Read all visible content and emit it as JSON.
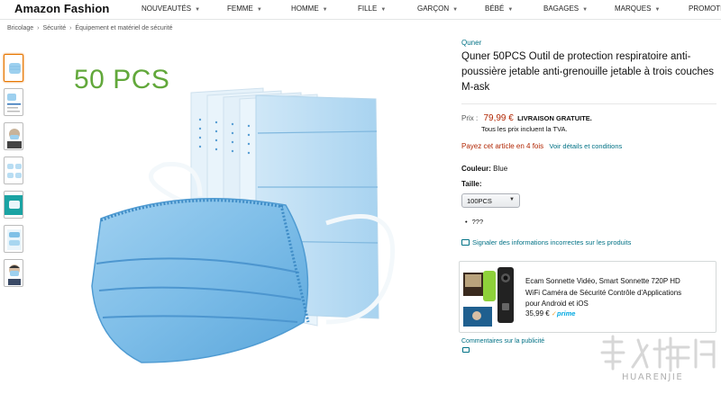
{
  "header": {
    "brand": "Amazon Fashion",
    "nav": [
      {
        "label": "NOUVEAUTÉS"
      },
      {
        "label": "FEMME"
      },
      {
        "label": "HOMME"
      },
      {
        "label": "FILLE"
      },
      {
        "label": "GARÇON"
      },
      {
        "label": "BÉBÉ"
      },
      {
        "label": "BAGAGES"
      },
      {
        "label": "MARQUES"
      },
      {
        "label": "PROMOTIO"
      }
    ]
  },
  "breadcrumb": {
    "items": [
      "Bricolage",
      "Sécurité",
      "Équipement et matériel de sécurité"
    ],
    "separator": "›"
  },
  "gallery": {
    "thumbnail_count": 7,
    "selected_index": 0,
    "main_overlay_text": "50 PCS"
  },
  "product": {
    "brand": "Quner",
    "title": "Quner 50PCS Outil de protection respiratoire anti-poussière jetable anti-grenouille jetable à trois couches M-ask",
    "price_label": "Prix :",
    "price": "79,99 €",
    "delivery": "LIVRAISON GRATUITE.",
    "tax_note": "Tous les prix incluent la TVA.",
    "installments_text": "Payez cet article en 4 fois",
    "installments_link": "Voir détails et conditions",
    "color_label": "Couleur:",
    "color_value": "Blue",
    "size_label": "Taille:",
    "size_selected": "100PCS",
    "bullet": "???",
    "report_link": "Signaler des informations incorrectes sur les produits"
  },
  "ad": {
    "title": "Ecam Sonnette Vidéo, Smart Sonnette 720P HD WiFi Caméra de Sécurité Contrôle d'Applications pour Android et iOS",
    "title_lines": [
      "Ecam Sonnette Vidéo, Smart Sonnette 720P HD",
      "WiFi Caméra de Sécurité Contrôle d'Applications",
      "pour Android et iOS"
    ],
    "price": "35,99 €",
    "prime": "prime",
    "comments": "Commentaires sur la publicité"
  },
  "watermark": {
    "text": "HUARENJIE"
  },
  "colors": {
    "price_red": "#B12704",
    "link_teal": "#007185",
    "pcs_green": "#62a83b",
    "mask_blue": "#8ec5ea",
    "selected_orange": "#e77600"
  },
  "icons": [
    "chevron-down-icon",
    "report-chat-icon",
    "ad-feedback-icon"
  ]
}
